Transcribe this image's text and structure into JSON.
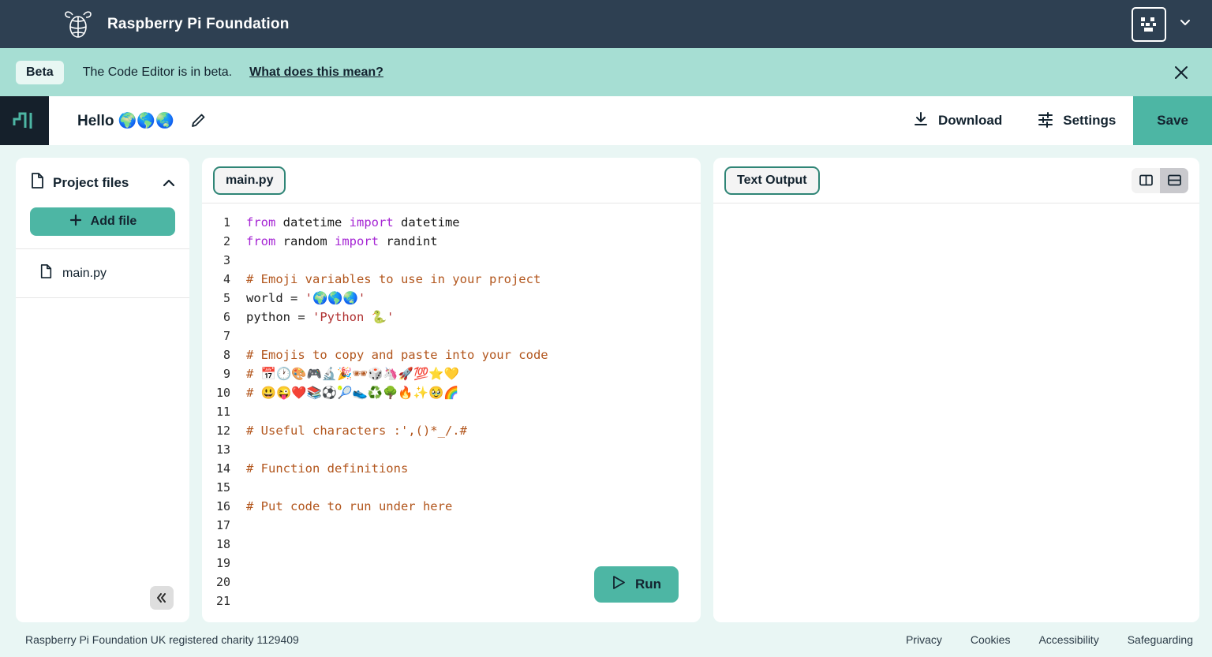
{
  "header": {
    "brand_title": "Raspberry Pi Foundation",
    "logo_icon": "raspberry-pi-logo",
    "avatar_icon": "pixel-face-avatar",
    "chevron_icon": "chevron-down-icon"
  },
  "beta_banner": {
    "pill": "Beta",
    "text": "The Code Editor is in beta.",
    "link": "What does this mean?",
    "close_icon": "close-icon"
  },
  "project_bar": {
    "editor_logo_icon": "code-editor-logo",
    "project_name": "Hello 🌍🌎🌏",
    "edit_icon": "pencil-icon",
    "download_label": "Download",
    "download_icon": "download-icon",
    "settings_label": "Settings",
    "settings_icon": "sliders-icon",
    "save_label": "Save"
  },
  "sidebar": {
    "title": "Project files",
    "file_icon": "file-icon",
    "collapse_chevron_icon": "chevron-up-icon",
    "add_file_label": "Add file",
    "add_file_icon": "plus-icon",
    "files": [
      {
        "name": "main.py",
        "icon": "file-icon"
      }
    ],
    "collapse_button_icon": "double-chevron-left-icon"
  },
  "editor": {
    "tab_label": "main.py",
    "run_label": "Run",
    "run_icon": "play-triangle-icon",
    "lines": [
      {
        "n": "1",
        "tokens": [
          {
            "t": "from",
            "c": "keyword"
          },
          {
            "t": " datetime ",
            "c": "plain"
          },
          {
            "t": "import",
            "c": "keyword"
          },
          {
            "t": " datetime",
            "c": "plain"
          }
        ]
      },
      {
        "n": "2",
        "tokens": [
          {
            "t": "from",
            "c": "keyword"
          },
          {
            "t": " random ",
            "c": "plain"
          },
          {
            "t": "import",
            "c": "keyword"
          },
          {
            "t": " randint",
            "c": "plain"
          }
        ]
      },
      {
        "n": "3",
        "tokens": []
      },
      {
        "n": "4",
        "tokens": [
          {
            "t": "# Emoji variables to use in your project",
            "c": "comment"
          }
        ]
      },
      {
        "n": "5",
        "tokens": [
          {
            "t": "world = ",
            "c": "plain"
          },
          {
            "t": "'🌍🌎🌏'",
            "c": "string"
          }
        ]
      },
      {
        "n": "6",
        "tokens": [
          {
            "t": "python = ",
            "c": "plain"
          },
          {
            "t": "'Python 🐍'",
            "c": "string"
          }
        ]
      },
      {
        "n": "7",
        "tokens": []
      },
      {
        "n": "8",
        "tokens": [
          {
            "t": "# Emojis to copy and paste into your code",
            "c": "comment"
          }
        ]
      },
      {
        "n": "9",
        "tokens": [
          {
            "t": "# 📅🕐🎨🎮🔬🎉🕶🎲🦄🚀💯⭐💛",
            "c": "comment"
          }
        ]
      },
      {
        "n": "10",
        "tokens": [
          {
            "t": "# 😃😜❤️📚⚽🎾👟♻️🌳🔥✨🥹🌈",
            "c": "comment"
          }
        ]
      },
      {
        "n": "11",
        "tokens": []
      },
      {
        "n": "12",
        "tokens": [
          {
            "t": "# Useful characters :',()*_/.#",
            "c": "comment"
          }
        ]
      },
      {
        "n": "13",
        "tokens": []
      },
      {
        "n": "14",
        "tokens": [
          {
            "t": "# Function definitions",
            "c": "comment"
          }
        ]
      },
      {
        "n": "15",
        "tokens": []
      },
      {
        "n": "16",
        "tokens": [
          {
            "t": "# Put code to run under here",
            "c": "comment"
          }
        ]
      },
      {
        "n": "17",
        "tokens": []
      },
      {
        "n": "18",
        "tokens": []
      },
      {
        "n": "19",
        "tokens": []
      },
      {
        "n": "20",
        "tokens": []
      },
      {
        "n": "21",
        "tokens": []
      }
    ]
  },
  "output": {
    "tab_label": "Text Output",
    "content": "",
    "layout_toggles": [
      {
        "icon": "split-vertical-icon",
        "active": false
      },
      {
        "icon": "split-horizontal-icon",
        "active": true
      }
    ]
  },
  "footer": {
    "charity_text": "Raspberry Pi Foundation UK registered charity 1129409",
    "links": [
      "Privacy",
      "Cookies",
      "Accessibility",
      "Safeguarding"
    ]
  },
  "colors": {
    "header_bg": "#2e4052",
    "banner_bg": "#a6ded3",
    "accent_teal": "#4db6a4",
    "tab_border": "#2f8576",
    "page_bg": "#e9f6f4",
    "comment": "#b2561d",
    "keyword": "#a626d4",
    "string": "#b03232"
  }
}
